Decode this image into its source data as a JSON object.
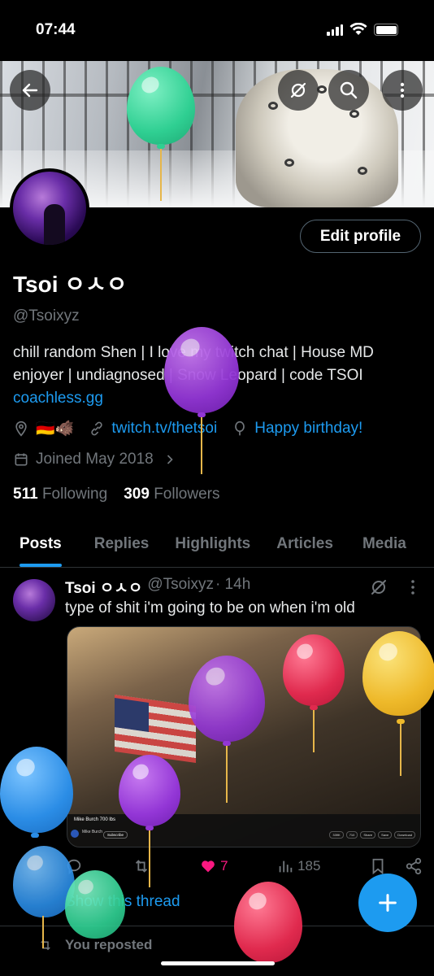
{
  "status_bar": {
    "time": "07:44"
  },
  "profile": {
    "name": "Tsoi ㅇㅅㅇ",
    "handle": "@Tsoixyz",
    "bio": "chill random Shen | I love my twitch chat | House MD enjoyer | undiagnosed | Snow Leopard | code TSOI",
    "bio_link": "coachless.gg",
    "flags": "🇩🇪🐗",
    "website": "twitch.tv/thetsoi",
    "birthday": "Happy birthday!",
    "joined": "Joined May 2018",
    "following_count": "511",
    "following_label": "Following",
    "followers_count": "309",
    "followers_label": "Followers",
    "edit_label": "Edit profile"
  },
  "tabs": [
    {
      "label": "Posts",
      "active": true
    },
    {
      "label": "Replies"
    },
    {
      "label": "Highlights"
    },
    {
      "label": "Articles"
    },
    {
      "label": "Media"
    }
  ],
  "post": {
    "author": "Tsoi ㅇㅅㅇ",
    "handle": "@Tsoixyz",
    "time": "· 14h",
    "text": "type of shit i'm going to be on when i'm old",
    "video": {
      "title": "Mike Burch 700 lbs",
      "channel": "Mike Burch",
      "subscribe": "Subscribe",
      "actions": [
        "339K",
        "710",
        "Share",
        "Save",
        "Download"
      ]
    },
    "likes": "7",
    "views": "185",
    "show_thread": "Show this thread"
  },
  "repost_label": "You reposted",
  "colors": {
    "accent": "#1d9bf0",
    "like": "#f91880",
    "muted": "#71767b"
  }
}
